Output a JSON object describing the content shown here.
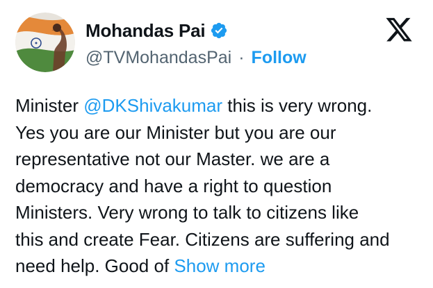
{
  "author": {
    "name": "Mohandas Pai",
    "handle": "@TVMohandasPai",
    "separator": "·",
    "follow_label": "Follow",
    "verified": true,
    "avatar_icon": "profile-avatar-with-indian-flag"
  },
  "brand": {
    "logo_icon": "x-logo-icon"
  },
  "tweet": {
    "line1_prefix": "Minister ",
    "mention": "@DKShivakumar",
    "line1_suffix": " this is very wrong.",
    "line2": "Yes you are our Minister but you are our",
    "line3": "representative not our Master. we are a",
    "line4": "democracy and have a right to question",
    "line5": "Ministers. Very wrong to talk to citizens like",
    "line6": "this and create Fear. Citizens are suffering and",
    "line7_prefix": "need help. Good of ",
    "show_more_label": "Show more"
  },
  "colors": {
    "link": "#1d9bf0",
    "text": "#0f1419",
    "secondary": "#536471",
    "verified_badge": "#1d9bf0"
  }
}
